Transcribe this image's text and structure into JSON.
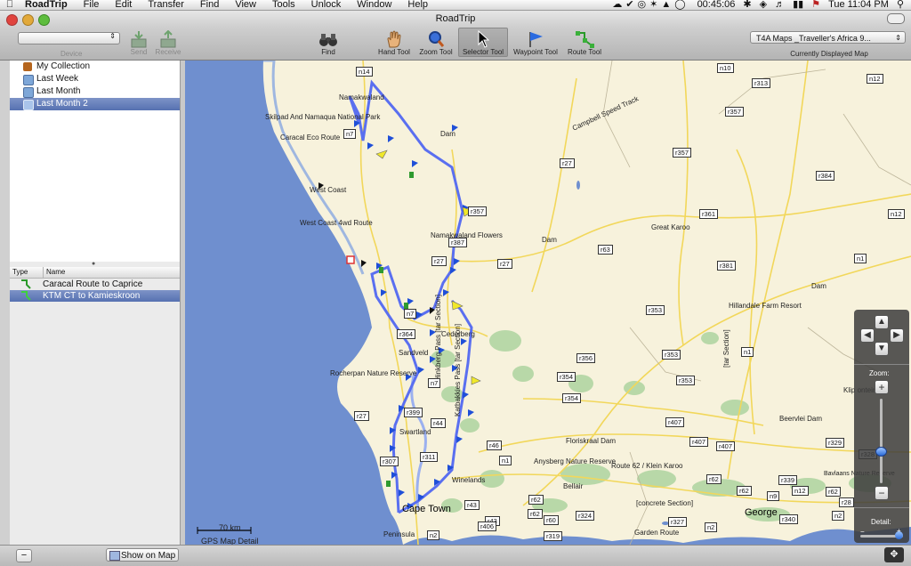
{
  "menubar": {
    "items": [
      "RoadTrip",
      "File",
      "Edit",
      "Transfer",
      "Find",
      "View",
      "Tools",
      "Unlock",
      "Window",
      "Help"
    ],
    "clock_timer": "00:45:06",
    "clock": "Tue 11:04 PM"
  },
  "window": {
    "title": "RoadTrip"
  },
  "toolbar": {
    "device_label": "Device",
    "send_label": "Send",
    "receive_label": "Receive",
    "find_label": "Find",
    "hand_label": "Hand Tool",
    "zoom_label": "Zoom Tool",
    "selector_label": "Selector Tool",
    "waypoint_label": "Waypoint Tool",
    "route_label": "Route Tool",
    "map_select_value": "T4A Maps _Traveller's Africa 9...",
    "map_select_caption": "Currently Displayed Map"
  },
  "sidebar": {
    "collections": [
      {
        "label": "My Collection",
        "icon": "briefcase-icon"
      },
      {
        "label": "Last Week",
        "icon": "calendar-icon"
      },
      {
        "label": "Last Month",
        "icon": "calendar-icon"
      },
      {
        "label": "Last Month 2",
        "icon": "calendar-icon",
        "selected": true
      }
    ],
    "routes_header": {
      "type": "Type",
      "name": "Name"
    },
    "routes": [
      {
        "name": "Caracal Route to Caprice",
        "icon": "route-icon"
      },
      {
        "name": "KTM CT to Kamieskroon",
        "icon": "route-icon",
        "selected": true
      }
    ]
  },
  "bottombar": {
    "show_map_label": "Show on Map"
  },
  "map": {
    "places": [
      "Namakwaland",
      "Skilpad And Namaqua National Park",
      "Caracal Eco Route",
      "Dam",
      "Campbell Speed Track",
      "West Coast",
      "West Coast 4wd Route",
      "Namakwaland Flowers",
      "Dam",
      "Great Karoo",
      "Hillandale Farm Resort",
      "Dam",
      "Cederberg",
      "Sandveld",
      "Rocherpan Nature Reserve",
      "Swartland",
      "Winelands",
      "Floriskraal Dam",
      "Anysberg Nature Reserve",
      "Route 62 / Klein Karoo",
      "Bellair",
      "[concrete Section]",
      "Garden Route",
      "Peninsula",
      "Beervlei Dam",
      "Klip ontein D",
      "Bavlaans Nature Reserve",
      "Hinkberg Pass [tar Section]",
      "Katbakkies Pass [tar Section]",
      "[tar Section]"
    ],
    "cities": [
      "Cape Town",
      "George"
    ],
    "roads": [
      "n14",
      "n10",
      "r313",
      "n12",
      "r357",
      "n7",
      "r357",
      "r27",
      "r357",
      "r384",
      "r361",
      "n12",
      "r387",
      "r63",
      "r381",
      "n1",
      "r27",
      "r27",
      "r353",
      "r364",
      "n7",
      "r356",
      "r353",
      "n1",
      "r354",
      "r354",
      "r353",
      "n7",
      "r399",
      "r44",
      "r407",
      "r407",
      "r27",
      "r46",
      "r407",
      "r328",
      "r307",
      "r311",
      "n1",
      "r329",
      "r62",
      "r62",
      "r339",
      "r62",
      "r43",
      "r62",
      "n9",
      "n12",
      "r43",
      "r62",
      "r324",
      "r327",
      "r340",
      "r406",
      "r60",
      "r319",
      "n2",
      "n2",
      "n2",
      "r28"
    ],
    "scale_label": "70 km",
    "scale_caption": "GPS Map Detail",
    "zoom_label": "Zoom:",
    "detail_label": "Detail:"
  },
  "colors": {
    "route": "#5a6ff0",
    "coast": "#6f8fcf",
    "land_green": "#b8d8a8",
    "selection": "#5671b1"
  }
}
